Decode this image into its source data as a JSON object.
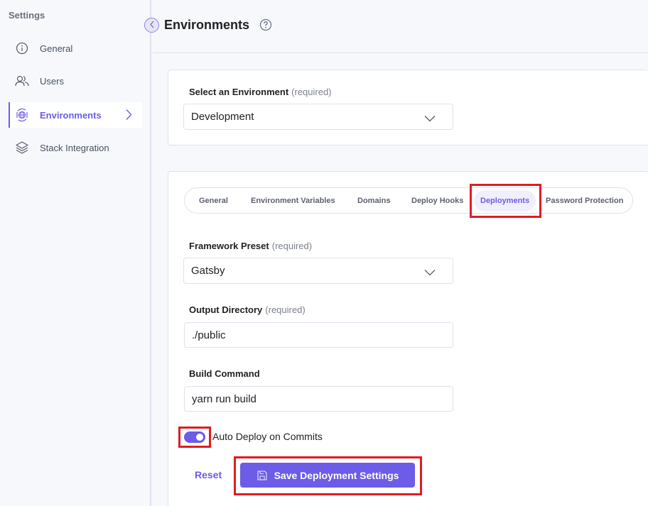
{
  "sidebar": {
    "title": "Settings",
    "items": [
      {
        "label": "General",
        "icon": "info-icon",
        "active": false
      },
      {
        "label": "Users",
        "icon": "users-icon",
        "active": false
      },
      {
        "label": "Environments",
        "icon": "environment-globe-icon",
        "active": true
      },
      {
        "label": "Stack Integration",
        "icon": "layers-icon",
        "active": false
      }
    ]
  },
  "header": {
    "title": "Environments",
    "help_icon": "question-circle-icon",
    "collapse_icon": "chevron-left-icon"
  },
  "environment_select": {
    "label": "Select an Environment",
    "required_note": "(required)",
    "value": "Development"
  },
  "tabs": [
    {
      "label": "General",
      "active": false
    },
    {
      "label": "Environment Variables",
      "active": false
    },
    {
      "label": "Domains",
      "active": false
    },
    {
      "label": "Deploy Hooks",
      "active": false
    },
    {
      "label": "Deployments",
      "active": true
    },
    {
      "label": "Password Protection",
      "active": false
    }
  ],
  "form": {
    "framework_preset": {
      "label": "Framework Preset",
      "required_note": "(required)",
      "value": "Gatsby"
    },
    "output_directory": {
      "label": "Output Directory",
      "required_note": "(required)",
      "value": "./public"
    },
    "build_command": {
      "label": "Build Command",
      "value": "yarn run build"
    },
    "auto_deploy": {
      "label": "Auto Deploy on Commits",
      "enabled": true
    }
  },
  "actions": {
    "reset_label": "Reset",
    "save_label": "Save Deployment Settings",
    "save_icon": "floppy-disk-icon"
  },
  "colors": {
    "accent": "#6c5ce7",
    "highlight": "#e11b22",
    "background": "#f7f8fc",
    "border": "#dde2ee"
  }
}
